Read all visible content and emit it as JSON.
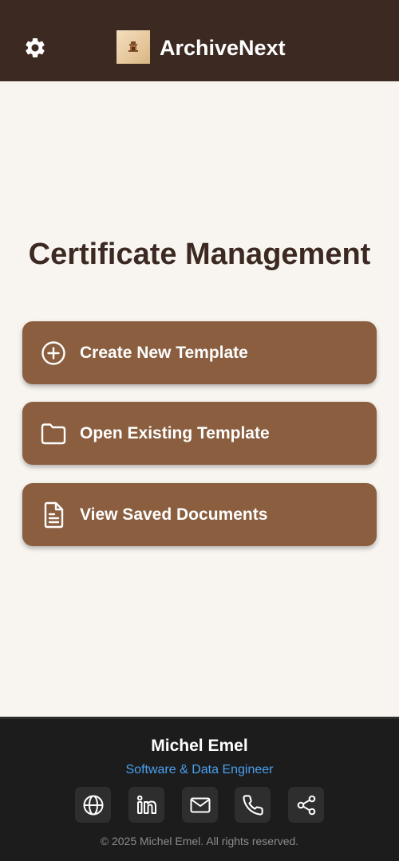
{
  "header": {
    "app_title": "ArchiveNext",
    "settings_icon": "gear-icon",
    "logo": "app-logo"
  },
  "main": {
    "title": "Certificate Management",
    "actions": [
      {
        "label": "Create New Template",
        "icon": "plus-circle-icon"
      },
      {
        "label": "Open Existing Template",
        "icon": "folder-icon"
      },
      {
        "label": "View Saved Documents",
        "icon": "document-icon"
      }
    ]
  },
  "footer": {
    "author_name": "Michel Emel",
    "author_role": "Software & Data Engineer",
    "social": [
      {
        "icon": "globe-icon"
      },
      {
        "icon": "linkedin-icon"
      },
      {
        "icon": "mail-icon"
      },
      {
        "icon": "phone-icon"
      },
      {
        "icon": "share-icon"
      }
    ],
    "copyright": "© 2025 Michel Emel. All rights reserved."
  },
  "colors": {
    "header_bg": "#3b2922",
    "page_bg": "#f8f4f0",
    "button_bg": "#8a5e3f",
    "footer_bg": "#1c1c1c",
    "accent_link": "#4aa0f0"
  }
}
